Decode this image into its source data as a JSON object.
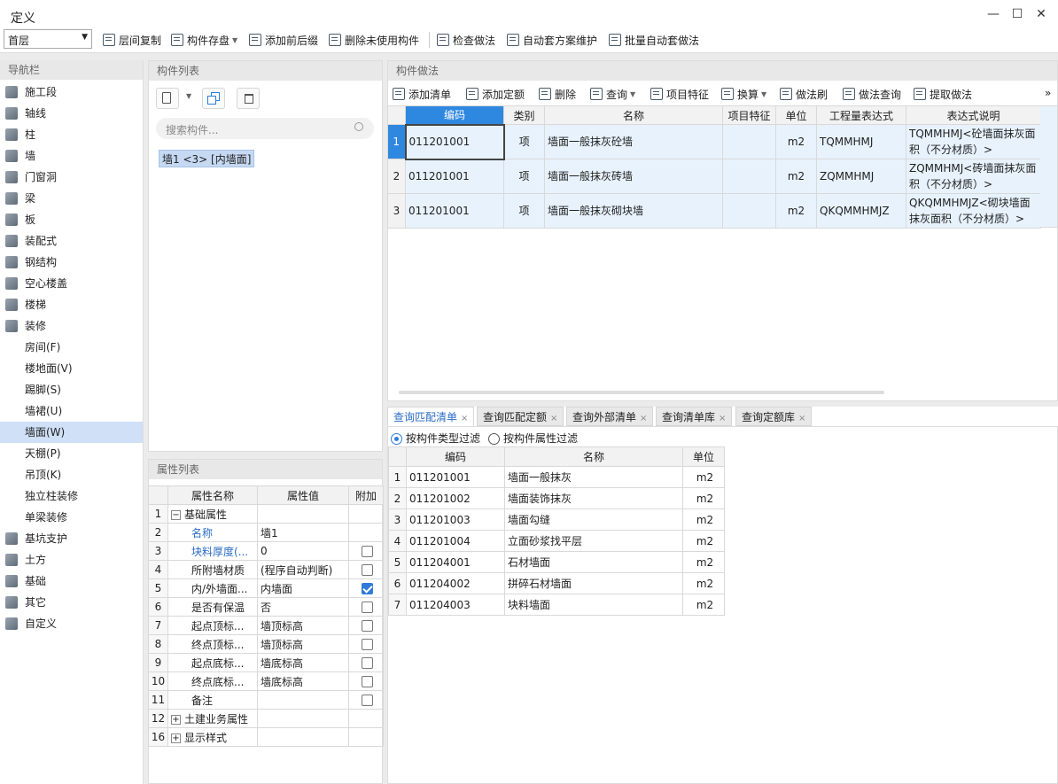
{
  "window": {
    "title": "定义",
    "minimize": "—",
    "maximize": "☐",
    "close": "✕"
  },
  "toolbar": {
    "floor": "首层",
    "items": [
      "层间复制",
      "构件存盘",
      "添加前后缀",
      "删除未使用构件",
      "检查做法",
      "自动套方案维护",
      "批量自动套做法"
    ]
  },
  "nav": {
    "title": "导航栏",
    "items": [
      {
        "label": "施工段",
        "icon": "construction-segment-icon"
      },
      {
        "label": "轴线",
        "icon": "grid-axis-icon"
      },
      {
        "label": "柱",
        "icon": "column-icon"
      },
      {
        "label": "墙",
        "icon": "wall-icon"
      },
      {
        "label": "门窗洞",
        "icon": "door-window-icon"
      },
      {
        "label": "梁",
        "icon": "beam-icon"
      },
      {
        "label": "板",
        "icon": "slab-icon"
      },
      {
        "label": "装配式",
        "icon": "prefab-icon"
      },
      {
        "label": "钢结构",
        "icon": "steel-structure-icon"
      },
      {
        "label": "空心楼盖",
        "icon": "hollow-floor-icon"
      },
      {
        "label": "楼梯",
        "icon": "stair-icon"
      },
      {
        "label": "装修",
        "icon": "decoration-icon"
      }
    ],
    "sub_items": [
      "房间(F)",
      "楼地面(V)",
      "踢脚(S)",
      "墙裙(U)",
      "墙面(W)",
      "天棚(P)",
      "吊顶(K)",
      "独立柱装修",
      "单梁装修"
    ],
    "selected_sub": "墙面(W)",
    "more_items": [
      {
        "label": "基坑支护",
        "icon": "pit-support-icon"
      },
      {
        "label": "土方",
        "icon": "earthwork-icon"
      },
      {
        "label": "基础",
        "icon": "foundation-icon"
      },
      {
        "label": "其它",
        "icon": "other-icon"
      },
      {
        "label": "自定义",
        "icon": "custom-icon"
      }
    ]
  },
  "component_list": {
    "title": "构件列表",
    "search_placeholder": "搜索构件...",
    "items": [
      "墙1 <3> [内墙面]"
    ]
  },
  "property_list": {
    "title": "属性列表",
    "columns": [
      "属性名称",
      "属性值",
      "附加"
    ],
    "rows": [
      {
        "num": "1",
        "name": "基础属性",
        "value": "",
        "group": "−",
        "check": null
      },
      {
        "num": "2",
        "name": "名称",
        "value": "墙1",
        "blue": true,
        "check": null
      },
      {
        "num": "3",
        "name": "块料厚度(...",
        "value": "0",
        "blue": true,
        "check": false
      },
      {
        "num": "4",
        "name": "所附墙材质",
        "value": "(程序自动判断)",
        "check": false
      },
      {
        "num": "5",
        "name": "内/外墙面...",
        "value": "内墙面",
        "check": true
      },
      {
        "num": "6",
        "name": "是否有保温",
        "value": "否",
        "check": false
      },
      {
        "num": "7",
        "name": "起点顶标...",
        "value": "墙顶标高",
        "check": false
      },
      {
        "num": "8",
        "name": "终点顶标...",
        "value": "墙顶标高",
        "check": false
      },
      {
        "num": "9",
        "name": "起点底标...",
        "value": "墙底标高",
        "check": false
      },
      {
        "num": "10",
        "name": "终点底标...",
        "value": "墙底标高",
        "check": false
      },
      {
        "num": "11",
        "name": "备注",
        "value": "",
        "check": false
      },
      {
        "num": "12",
        "name": "土建业务属性",
        "value": "",
        "group": "+",
        "check": null
      },
      {
        "num": "16",
        "name": "显示样式",
        "value": "",
        "group": "+",
        "check": null
      }
    ]
  },
  "method": {
    "title": "构件做法",
    "toolbar": [
      "添加清单",
      "添加定额",
      "删除",
      "查询",
      "项目特征",
      "换算",
      "做法刷",
      "做法查询",
      "提取做法"
    ],
    "more": "»",
    "columns": [
      "编码",
      "类别",
      "名称",
      "项目特征",
      "单位",
      "工程量表达式",
      "表达式说明"
    ],
    "rows": [
      {
        "num": "1",
        "code": "011201001",
        "type": "项",
        "name": "墙面一般抹灰砼墙",
        "feature": "",
        "unit": "m2",
        "expr": "TQMMHMJ",
        "desc": "TQMMHMJ<砼墙面抹灰面积（不分材质）>"
      },
      {
        "num": "2",
        "code": "011201001",
        "type": "项",
        "name": "墙面一般抹灰砖墙",
        "feature": "",
        "unit": "m2",
        "expr": "ZQMMHMJ",
        "desc": "ZQMMHMJ<砖墙面抹灰面积（不分材质）>"
      },
      {
        "num": "3",
        "code": "011201001",
        "type": "项",
        "name": "墙面一般抹灰砌块墙",
        "feature": "",
        "unit": "m2",
        "expr": "QKQMMHMJZ",
        "desc": "QKQMMHMJZ<砌块墙面抹灰面积（不分材质）>"
      }
    ]
  },
  "query": {
    "tabs": [
      "查询匹配清单",
      "查询匹配定额",
      "查询外部清单",
      "查询清单库",
      "查询定额库"
    ],
    "tab_close": "×",
    "filter_options": [
      "按构件类型过滤",
      "按构件属性过滤"
    ],
    "columns": [
      "编码",
      "名称",
      "单位"
    ],
    "rows": [
      {
        "num": "1",
        "code": "011201001",
        "name": "墙面一般抹灰",
        "unit": "m2"
      },
      {
        "num": "2",
        "code": "011201002",
        "name": "墙面装饰抹灰",
        "unit": "m2"
      },
      {
        "num": "3",
        "code": "011201003",
        "name": "墙面勾缝",
        "unit": "m2"
      },
      {
        "num": "4",
        "code": "011201004",
        "name": "立面砂浆找平层",
        "unit": "m2"
      },
      {
        "num": "5",
        "code": "011204001",
        "name": "石材墙面",
        "unit": "m2"
      },
      {
        "num": "6",
        "code": "011204002",
        "name": "拼碎石材墙面",
        "unit": "m2"
      },
      {
        "num": "7",
        "code": "011204003",
        "name": "块料墙面",
        "unit": "m2"
      }
    ]
  },
  "colors": {
    "accent": "#2f88e0",
    "selection": "#cfe0f7",
    "row_bg": "#e7f2fc"
  }
}
